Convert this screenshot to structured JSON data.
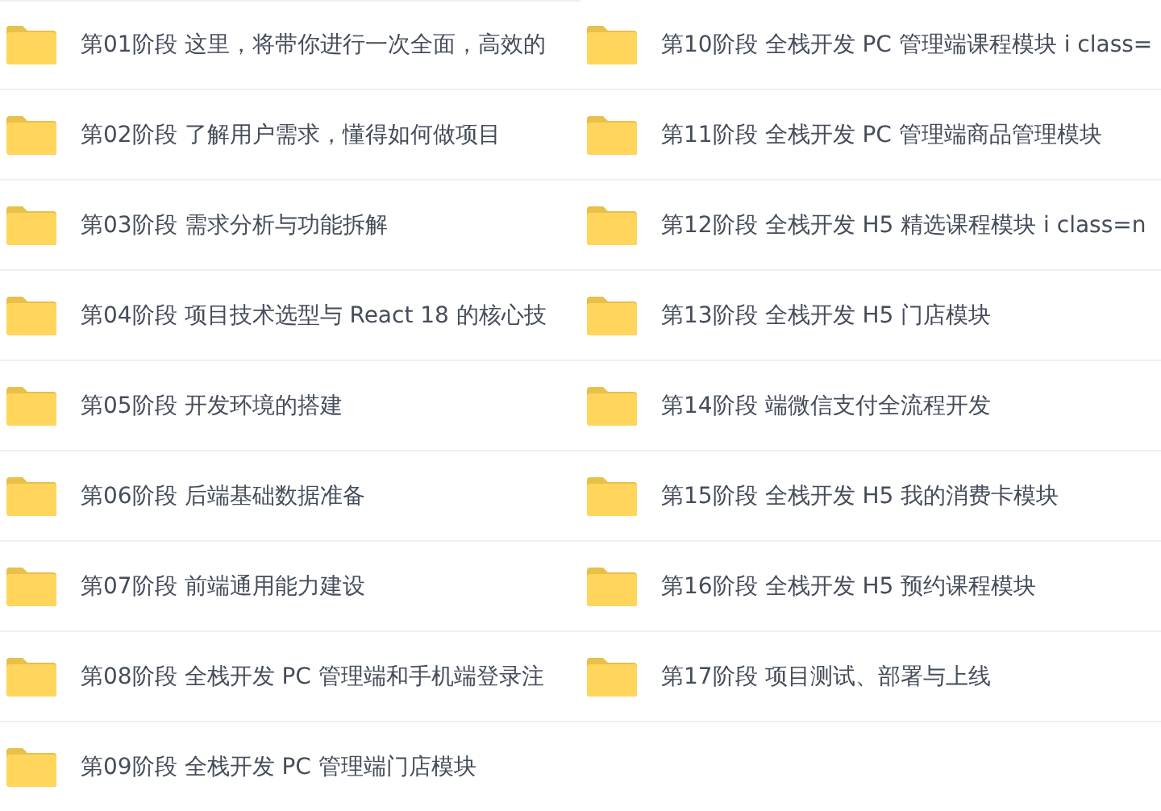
{
  "folders": [
    {
      "name": "第01阶段 这里，将带你进行一次全面，高效的"
    },
    {
      "name": "第02阶段 了解用户需求，懂得如何做项目"
    },
    {
      "name": "第03阶段 需求分析与功能拆解"
    },
    {
      "name": "第04阶段 项目技术选型与 React 18 的核心技"
    },
    {
      "name": "第05阶段 开发环境的搭建"
    },
    {
      "name": "第06阶段 后端基础数据准备"
    },
    {
      "name": "第07阶段 前端通用能力建设"
    },
    {
      "name": "第08阶段 全栈开发 PC 管理端和手机端登录注"
    },
    {
      "name": "第09阶段 全栈开发 PC 管理端门店模块"
    },
    {
      "name": "第10阶段 全栈开发 PC 管理端课程模块 i class="
    },
    {
      "name": "第11阶段 全栈开发 PC 管理端商品管理模块"
    },
    {
      "name": "第12阶段 全栈开发 H5 精选课程模块 i class=n"
    },
    {
      "name": "第13阶段 全栈开发 H5 门店模块"
    },
    {
      "name": "第14阶段 端微信支付全流程开发"
    },
    {
      "name": "第15阶段 全栈开发 H5 我的消费卡模块"
    },
    {
      "name": "第16阶段 全栈开发 H5 预约课程模块"
    },
    {
      "name": "第17阶段 项目测试、部署与上线"
    }
  ]
}
